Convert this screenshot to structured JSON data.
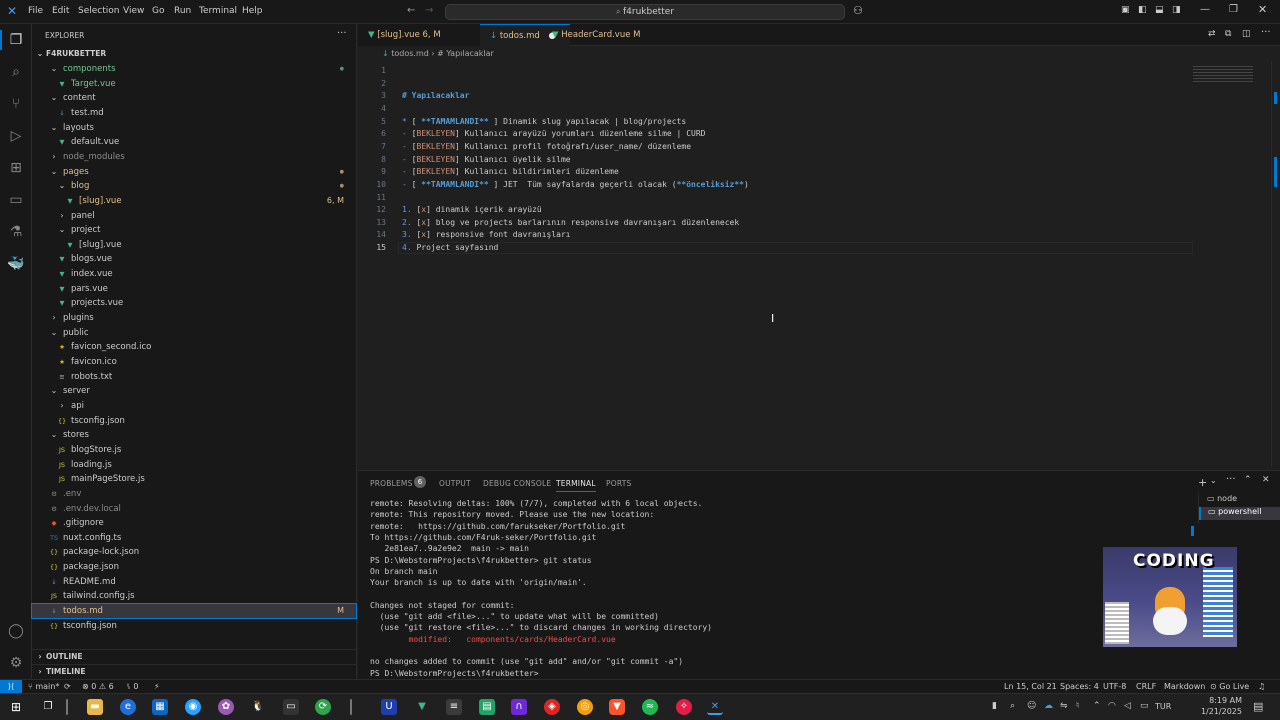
{
  "titlebar": {
    "menus": [
      "File",
      "Edit",
      "Selection",
      "View",
      "Go",
      "Run",
      "Terminal",
      "Help"
    ],
    "search": "f4rukbetter"
  },
  "sidebar": {
    "title": "EXPLORER",
    "root": "F4RUKBETTER",
    "tree": [
      {
        "label": "components",
        "type": "folder",
        "open": true,
        "depth": 1,
        "color": "#73c991",
        "badge": "dot"
      },
      {
        "label": "Target.vue",
        "type": "vue",
        "depth": 2,
        "color": "#73c991"
      },
      {
        "label": "content",
        "type": "folder",
        "open": true,
        "depth": 1,
        "color": "#cccccc"
      },
      {
        "label": "test.md",
        "type": "md",
        "depth": 2,
        "color": "#cccccc"
      },
      {
        "label": "layouts",
        "type": "folder",
        "open": true,
        "depth": 1,
        "color": "#cccccc"
      },
      {
        "label": "default.vue",
        "type": "vue",
        "depth": 2,
        "color": "#cccccc"
      },
      {
        "label": "node_modules",
        "type": "folder",
        "open": false,
        "depth": 1,
        "color": "#8c8c8c"
      },
      {
        "label": "pages",
        "type": "folder",
        "open": true,
        "depth": 1,
        "color": "#e2c08d",
        "badge": "dot"
      },
      {
        "label": "blog",
        "type": "folder",
        "open": true,
        "depth": 2,
        "color": "#e2c08d",
        "badge": "dot"
      },
      {
        "label": "[slug].vue",
        "type": "vue",
        "depth": 3,
        "color": "#e2c08d",
        "badge": "6, M"
      },
      {
        "label": "panel",
        "type": "folder",
        "open": false,
        "depth": 2,
        "color": "#cccccc"
      },
      {
        "label": "project",
        "type": "folder",
        "open": true,
        "depth": 2,
        "color": "#cccccc"
      },
      {
        "label": "[slug].vue",
        "type": "vue",
        "depth": 3,
        "color": "#cccccc"
      },
      {
        "label": "blogs.vue",
        "type": "vue",
        "depth": 2,
        "color": "#cccccc"
      },
      {
        "label": "index.vue",
        "type": "vue",
        "depth": 2,
        "color": "#cccccc"
      },
      {
        "label": "pars.vue",
        "type": "vue",
        "depth": 2,
        "color": "#cccccc"
      },
      {
        "label": "projects.vue",
        "type": "vue",
        "depth": 2,
        "color": "#cccccc"
      },
      {
        "label": "plugins",
        "type": "folder",
        "open": false,
        "depth": 1,
        "color": "#cccccc"
      },
      {
        "label": "public",
        "type": "folder",
        "open": true,
        "depth": 1,
        "color": "#cccccc"
      },
      {
        "label": "favicon_second.ico",
        "type": "ico",
        "depth": 2,
        "color": "#cccccc"
      },
      {
        "label": "favicon.ico",
        "type": "ico",
        "depth": 2,
        "color": "#cccccc"
      },
      {
        "label": "robots.txt",
        "type": "txt",
        "depth": 2,
        "color": "#cccccc"
      },
      {
        "label": "server",
        "type": "folder",
        "open": true,
        "depth": 1,
        "color": "#cccccc"
      },
      {
        "label": "api",
        "type": "folder",
        "open": false,
        "depth": 2,
        "color": "#cccccc"
      },
      {
        "label": "tsconfig.json",
        "type": "json",
        "depth": 2,
        "color": "#cccccc"
      },
      {
        "label": "stores",
        "type": "folder",
        "open": true,
        "depth": 1,
        "color": "#cccccc"
      },
      {
        "label": "blogStore.js",
        "type": "js",
        "depth": 2,
        "color": "#cccccc"
      },
      {
        "label": "loading.js",
        "type": "js",
        "depth": 2,
        "color": "#cccccc"
      },
      {
        "label": "mainPageStore.js",
        "type": "js",
        "depth": 2,
        "color": "#cccccc"
      },
      {
        "label": ".env",
        "type": "env",
        "depth": 1,
        "color": "#8c8c8c"
      },
      {
        "label": ".env.dev.local",
        "type": "env",
        "depth": 1,
        "color": "#8c8c8c"
      },
      {
        "label": ".gitignore",
        "type": "git",
        "depth": 1,
        "color": "#cccccc"
      },
      {
        "label": "nuxt.config.ts",
        "type": "ts",
        "depth": 1,
        "color": "#cccccc"
      },
      {
        "label": "package-lock.json",
        "type": "json",
        "depth": 1,
        "color": "#cccccc"
      },
      {
        "label": "package.json",
        "type": "json",
        "depth": 1,
        "color": "#cccccc"
      },
      {
        "label": "README.md",
        "type": "md",
        "depth": 1,
        "color": "#cccccc"
      },
      {
        "label": "tailwind.config.js",
        "type": "js",
        "depth": 1,
        "color": "#cccccc"
      },
      {
        "label": "todos.md",
        "type": "md",
        "depth": 1,
        "color": "#e2c08d",
        "badge": "M",
        "selected": true
      },
      {
        "label": "tsconfig.json",
        "type": "json",
        "depth": 1,
        "color": "#cccccc"
      }
    ],
    "outline": "OUTLINE",
    "timeline": "TIMELINE"
  },
  "tabs": [
    {
      "label": "[slug].vue",
      "badge": "6, M",
      "color": "#e2c08d",
      "active": false
    },
    {
      "label": "todos.md",
      "badge": "●",
      "color": "#e2c08d",
      "active": true
    },
    {
      "label": "HeaderCard.vue",
      "badge": "M",
      "color": "#e2c08d",
      "active": false
    }
  ],
  "breadcrumb": {
    "file": "todos.md",
    "sep": "›",
    "section": "# Yapılacaklar"
  },
  "editor": {
    "current_line": 15,
    "lines": [
      "",
      "",
      "# Yapılacaklar",
      "",
      "* [ **TAMAMLANDI** ] Dinamik slug yapılacak | blog/projects",
      "- [BEKLEYEN] Kullanıcı arayüzü yorumları düzenleme silme | CURD",
      "- [BEKLEYEN] Kullanıcı profil fotoğrafı/user_name/ düzenleme",
      "- [BEKLEYEN] Kullanıcı üyelik silme",
      "- [BEKLEYEN] Kullanıcı bildirimleri düzenleme",
      "- [ **TAMAMLANDI** ] JET  Tüm sayfalarda geçerli olacak (**önceliksiz**)",
      "",
      "1. [x] dinamik içerik arayüzü",
      "2. [x] blog ve projects barlarının responsive davranışarı düzenlenecek",
      "3. [x] responsive font davranışları",
      "4. Project sayfasınd"
    ]
  },
  "panel": {
    "tabs": [
      "PROBLEMS",
      "OUTPUT",
      "DEBUG CONSOLE",
      "TERMINAL",
      "PORTS"
    ],
    "problems_count": "6",
    "terminals": [
      "node",
      "powershell"
    ],
    "lines": [
      "remote: Resolving deltas: 100% (7/7), completed with 6 local objects.",
      "remote: This repository moved. Please use the new location:",
      "remote:   https://github.com/farukseker/Portfolio.git",
      "To https://github.com/F4ruk-seker/Portfolio.git",
      "   2e81ea7..9a2e9e2  main -> main",
      "PS D:\\WebstormProjects\\f4rukbetter> git status",
      "On branch main",
      "Your branch is up to date with 'origin/main'.",
      "",
      "Changes not staged for commit:",
      "  (use \"git add <file>...\" to update what will be committed)",
      "  (use \"git restore <file>...\" to discard changes in working directory)",
      "        modified:   components/cards/HeaderCard.vue",
      "",
      "no changes added to commit (use \"git add\" and/or \"git commit -a\")",
      "PS D:\\WebstormProjects\\f4rukbetter> "
    ],
    "overlay_text": "CODING"
  },
  "statusbar": {
    "branch": "main*",
    "errors": "0",
    "warnings": "6",
    "ports": "0",
    "position": "Ln 15, Col 21",
    "spaces": "Spaces: 4",
    "encoding": "UTF-8",
    "eol": "CRLF",
    "language": "Markdown",
    "golive": "Go Live"
  },
  "taskbar": {
    "lang": "TUR",
    "time": "8:19 AM",
    "date": "1/21/2025"
  },
  "colors": {
    "accent": "#0078d4",
    "modified": "#e2c08d",
    "added": "#73c991",
    "heading": "#569cd6",
    "bold": "#569cd6",
    "list_marker": "#6796e6",
    "bracket_text": "#ce9178"
  }
}
